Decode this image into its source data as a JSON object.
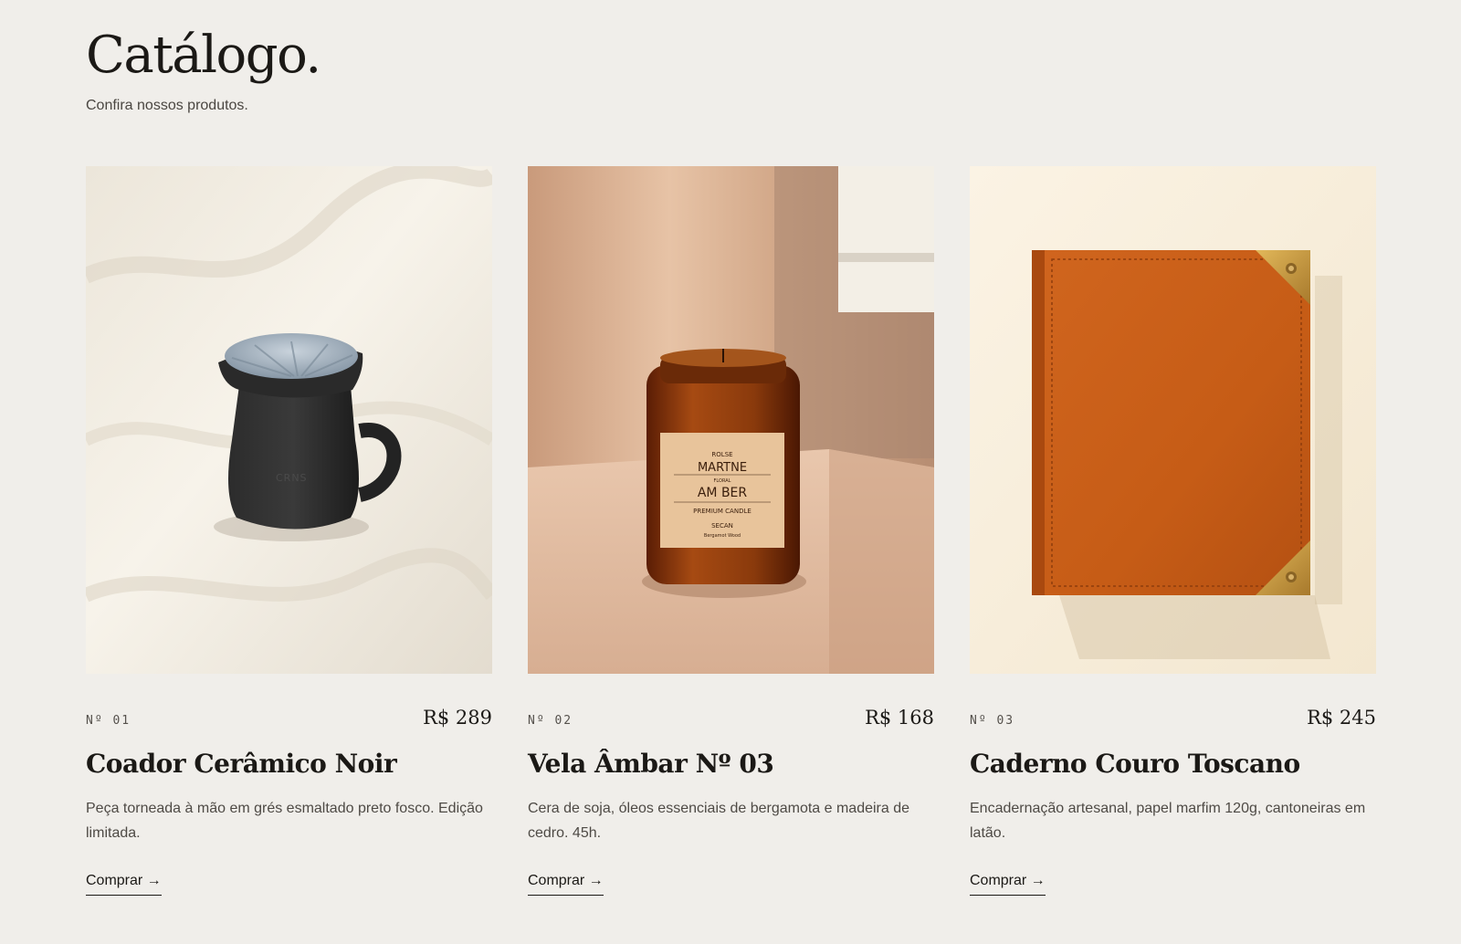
{
  "header": {
    "title": "Catálogo.",
    "subtitle": "Confira nossos produtos."
  },
  "products": [
    {
      "number": "Nº 01",
      "price": "R$ 289",
      "name": "Coador Cerâmico Noir",
      "description": "Peça torneada à mão em grés esmaltado preto fosco. Edição limitada.",
      "cta": "Comprar →",
      "image_text": "CRNS"
    },
    {
      "number": "Nº 02",
      "price": "R$ 168",
      "name": "Vela Âmbar Nº 03",
      "description": "Cera de soja, óleos essenciais de bergamota e madeira de cedro. 45h.",
      "cta": "Comprar →",
      "image_text": [
        "ROLSE",
        "MARTNE",
        "FLORAL",
        "AM BER",
        "PREMIUM CANDLE",
        "SECAN",
        "Bergamot Wood"
      ]
    },
    {
      "number": "Nº 03",
      "price": "R$ 245",
      "name": "Caderno Couro Toscano",
      "description": "Encadernação artesanal, papel marfim 120g, cantoneiras em latão.",
      "cta": "Comprar →"
    }
  ],
  "colors": {
    "background": "#f0eeea",
    "text": "#1b1916",
    "leather": "#c8621e",
    "amber": "#8a3a0c"
  }
}
